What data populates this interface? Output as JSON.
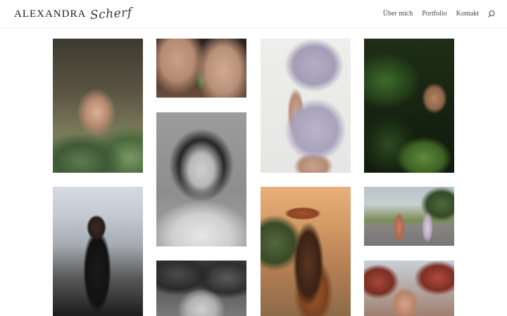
{
  "header": {
    "logo_main": "ALEXANDRA",
    "logo_script": "Scherf",
    "nav": [
      {
        "label": "Über mich"
      },
      {
        "label": "Portfolio"
      },
      {
        "label": "Kontakt"
      }
    ],
    "search_icon": "search-icon"
  },
  "gallery": {
    "photos": [
      {
        "name": "portrait-woman-in-leaves"
      },
      {
        "name": "legs-with-leaves"
      },
      {
        "name": "lilac-outfit-detail"
      },
      {
        "name": "woman-in-jungle-plants"
      },
      {
        "name": "black-and-white-portrait-eyes-closed"
      },
      {
        "name": "woman-at-piano"
      },
      {
        "name": "woman-in-hat-sunset"
      },
      {
        "name": "two-women-walking-road"
      },
      {
        "name": "black-and-white-face-in-leaves"
      },
      {
        "name": "man-under-red-leaves"
      }
    ]
  },
  "colors": {
    "background": "#ffffff",
    "text": "#444444",
    "header_border": "#efefef"
  }
}
